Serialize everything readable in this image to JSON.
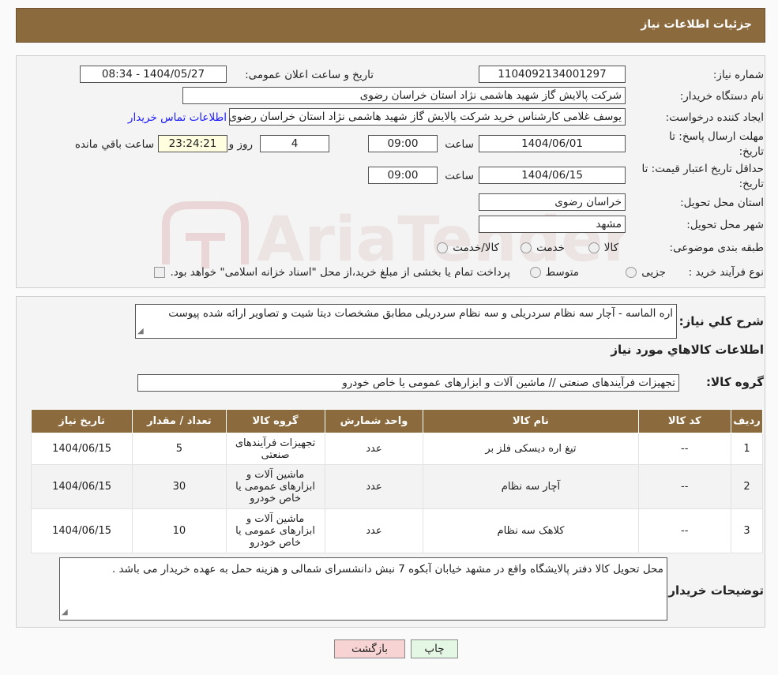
{
  "header": {
    "title": "جزئیات اطلاعات نیاز"
  },
  "form": {
    "need_number_label": "شماره نیاز:",
    "need_number": "1104092134001297",
    "announce_label": "تاریخ و ساعت اعلان عمومی:",
    "announce_value": "1404/05/27 - 08:34",
    "buyer_org_label": "نام دستگاه خریدار:",
    "buyer_org": "شرکت پالایش گاز شهید هاشمی نژاد   استان خراسان رضوی",
    "requester_label": "ایجاد کننده درخواست:",
    "requester": "یوسف غلامی کارشناس خرید شرکت پالایش گاز شهید هاشمی نژاد   استان خراسان رضوی",
    "contact_link": "اطلاعات تماس خریدار",
    "deadline_label_1": "مهلت ارسال پاسخ: تا",
    "deadline_label_2": "تاریخ:",
    "deadline_date": "1404/06/01",
    "time_label": "ساعت",
    "deadline_time": "09:00",
    "days_value": "4",
    "days_label": "روز و",
    "remaining_time": "23:24:21",
    "remaining_label": "ساعت باقي مانده",
    "validity_label_1": "حداقل تاریخ اعتبار قیمت: تا",
    "validity_label_2": "تاریخ:",
    "validity_date": "1404/06/15",
    "validity_time": "09:00",
    "province_label": "استان محل تحویل:",
    "province": "خراسان رضوی",
    "city_label": "شهر محل تحویل:",
    "city": "مشهد",
    "category_label": "طبقه بندی موضوعی:",
    "category_options": [
      "کالا",
      "خدمت",
      "کالا/خدمت"
    ],
    "process_label": "نوع فرآیند خرید :",
    "process_options": [
      "جزیی",
      "متوسط"
    ],
    "process_note": "پرداخت تمام یا بخشی از مبلغ خرید،از محل \"اسناد خزانه اسلامی\" خواهد بود."
  },
  "details": {
    "summary_label": "شرح کلي نیاز:",
    "summary": "اره الماسه - آچار سه نظام سردریلی و سه نظام سردریلی مطابق مشخصات دیتا شیت و تصاویر ارائه شده پیوست",
    "goods_info_title": "اطلاعات کالاهاي مورد نیاز",
    "goods_group_label": "گروه کالا:",
    "goods_group": "تجهیزات فرآیندهای صنعتی //  ماشین آلات و ابزارهای عمومی یا خاص خودرو",
    "table": {
      "headers": [
        "ردیف",
        "کد کالا",
        "نام کالا",
        "واحد شمارش",
        "گروه کالا",
        "تعداد / مقدار",
        "تاریخ نیاز"
      ],
      "rows": [
        [
          "1",
          "--",
          "تیغ اره دیسکی فلز بر",
          "عدد",
          "تجهیزات فرآیندهای صنعتی",
          "5",
          "1404/06/15"
        ],
        [
          "2",
          "--",
          "آچار سه نظام",
          "عدد",
          "ماشین آلات و ابزارهای عمومی یا خاص خودرو",
          "30",
          "1404/06/15"
        ],
        [
          "3",
          "--",
          "کلاهک سه نظام",
          "عدد",
          "ماشین آلات و ابزارهای عمومی یا خاص خودرو",
          "10",
          "1404/06/15"
        ]
      ]
    },
    "buyer_notes_label": "توضیحات خریدار:",
    "buyer_notes": "محل تحویل کالا دفتر پالایشگاه واقع در مشهد خیابان آبکوه 7 نبش دانشسرای شمالی و هزینه حمل به عهده خریدار می باشد ."
  },
  "buttons": {
    "print": "چاپ",
    "back": "بازگشت"
  },
  "colors": {
    "header_bg": "#8b6a3e",
    "back_button_bg": "#f8d3d3",
    "print_button_bg": "#e4f6e4",
    "link": "#1a1aff"
  }
}
